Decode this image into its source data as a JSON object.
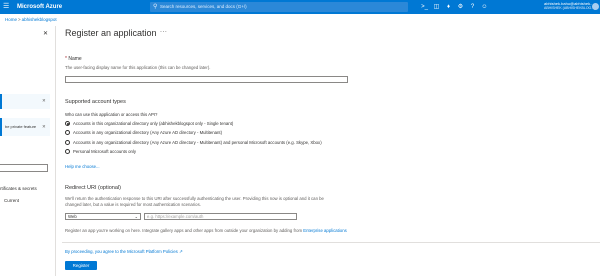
{
  "topbar": {
    "menu_icon": "hamburger-icon",
    "brand": "Microsoft Azure",
    "search_placeholder": "Search resources, services, and docs (G+/)",
    "icons": [
      "cloud-shell-icon",
      "directory-filter-icon",
      "bell-icon",
      "gear-icon",
      "help-icon",
      "feedback-icon"
    ],
    "user_name": "abhishek.bahu@abhishek...",
    "user_tenant": "ABHISHEK (ABHISHEKBLOG...)"
  },
  "breadcrumb": [
    "Home",
    "abhishekblogspot"
  ],
  "left_panel": {
    "notice_text": "be private feature",
    "item_certificates": "rtificates & secrets",
    "item_current": "Current"
  },
  "page": {
    "title": "Register an application",
    "more": "..."
  },
  "name_section": {
    "label": "Name",
    "required_mark": "*",
    "help": "The user-facing display name for this application (this can be changed later).",
    "value": ""
  },
  "account_types": {
    "heading": "Supported account types",
    "question": "Who can use this application or access this API?",
    "options": [
      "Accounts in this organizational directory only (abhishekblogspot only - Single tenant)",
      "Accounts in any organizational directory (Any Azure AD directory - Multitenant)",
      "Accounts in any organizational directory (Any Azure AD directory - Multitenant) and personal Microsoft accounts (e.g. Skype, Xbox)",
      "Personal Microsoft accounts only"
    ],
    "selected_index": 0,
    "help_link": "Help me choose..."
  },
  "redirect": {
    "heading": "Redirect URI (optional)",
    "help_line1": "We'll return the authentication response to this URI after successfully authenticating the user. Providing this now is optional and it can be",
    "help_line2": "changed later, but a value is required for most authentication scenarios.",
    "platform": "Web",
    "uri_placeholder": "e.g. https://example.com/auth",
    "gallery_text": "Register an app you're working on here. Integrate gallery apps and other apps from outside your organization by adding from",
    "gallery_link": "Enterprise applications"
  },
  "footer": {
    "policy_text": "By proceeding, you agree to the Microsoft Platform Policies",
    "register_label": "Register"
  }
}
